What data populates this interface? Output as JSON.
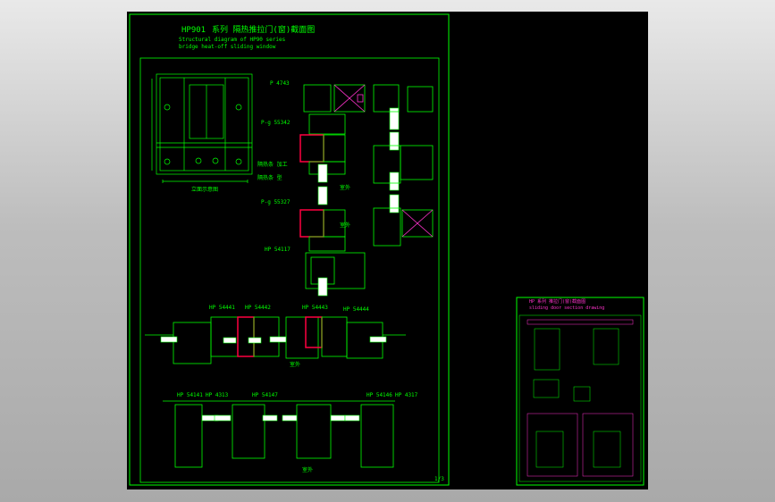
{
  "drawing": {
    "title": "HP901",
    "title_cn": "系列 隔热推拉门(窗)截面图",
    "subtitle_line1": "Structural diagram of HP90 series",
    "subtitle_line2": "bridge heat-off sliding window",
    "elevation_caption": "立面示意图",
    "profile_labels": {
      "p1": "P 4743",
      "p2": "P-g 55342",
      "p3": "隔热条 加工",
      "p4": "隔热条 型",
      "p5": "P-g 55327",
      "p6": "HP 54117",
      "s1": "HP 54441",
      "s2": "HP 54442",
      "s3": "HP 54443",
      "s4": "HP 54444",
      "b1": "HP 54141",
      "b2": "HP 4313",
      "b3": "HP 54147",
      "b4": "HP 54146",
      "b5": "HP 4317",
      "side1": "室外",
      "side2": "室外",
      "side3": "室外",
      "side4": "室外"
    },
    "page_number": "1/3",
    "inset_title": "HP 系列 推拉门(窗)截面图",
    "inset_sub": "sliding door section drawing"
  },
  "colors": {
    "canvas": "#000000",
    "line": "#00ff00",
    "accent": "#ff33cc",
    "highlight": "#ff0040",
    "glass": "#ffffff"
  }
}
